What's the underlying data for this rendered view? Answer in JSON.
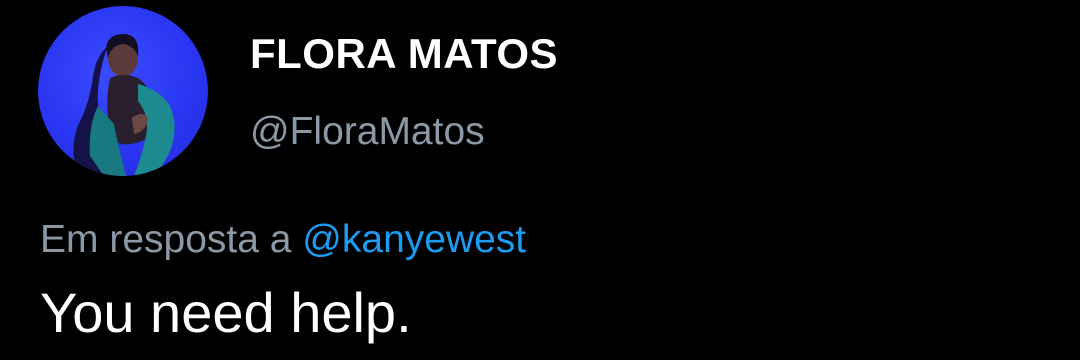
{
  "author": {
    "display_name": "FLORA MATOS",
    "handle": "@FloraMatos",
    "avatar_icon": "profile-photo"
  },
  "reply": {
    "prefix": "Em resposta a",
    "mention": "@kanyewest"
  },
  "tweet": {
    "text": "You need help."
  },
  "colors": {
    "background": "#000000",
    "primary_text": "#ffffff",
    "secondary_text": "#8b98a5",
    "link": "#1d9bf0",
    "avatar_bg": "#2a36f2"
  }
}
